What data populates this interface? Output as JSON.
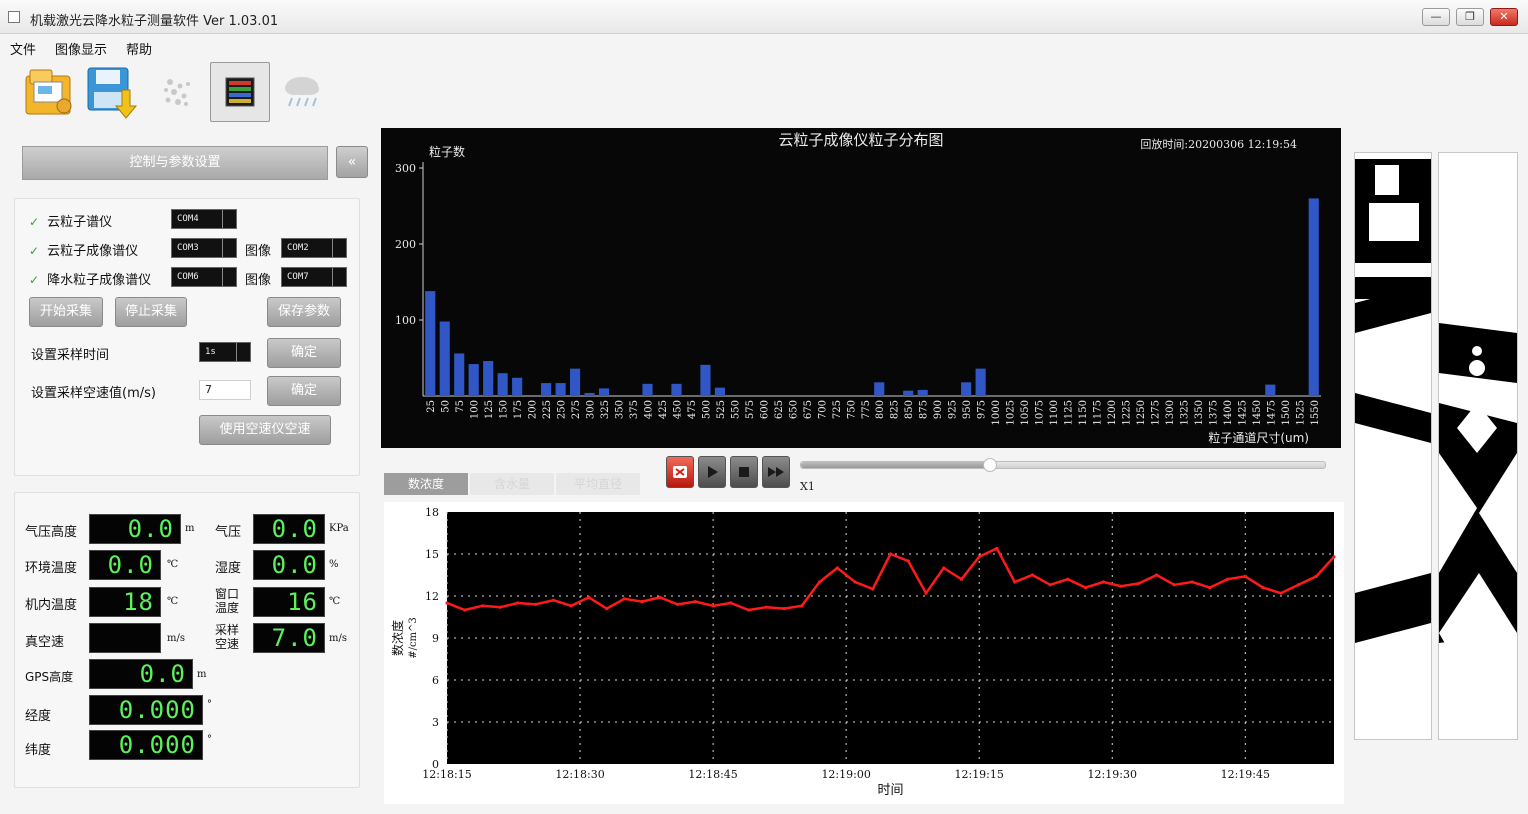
{
  "window": {
    "title": "机载激光云降水粒子测量软件 Ver 1.03.01",
    "buttons": {
      "minimize": "—",
      "maximize": "❐",
      "close": "✕"
    }
  },
  "menu": [
    "文件",
    "图像显示",
    "帮助"
  ],
  "toolbar": {
    "icons": [
      "open-folder-icon",
      "save-icon",
      "particles-icon",
      "color-bars-icon",
      "cloud-rain-icon"
    ]
  },
  "panel": {
    "header": "控制与参数设置",
    "collapse": "«",
    "instruments": [
      {
        "label": "云粒子谱仪",
        "port": "COM4"
      },
      {
        "label": "云粒子成像谱仪",
        "port": "COM3",
        "image_label": "图像",
        "image_port": "COM2"
      },
      {
        "label": "降水粒子成像谱仪",
        "port": "COM6",
        "image_label": "图像",
        "image_port": "COM7"
      }
    ],
    "start_button": "开始采集",
    "stop_button": "停止采集",
    "save_button": "保存参数",
    "sample_time_label": "设置采样时间",
    "sample_time_value": "1s",
    "sample_speed_label": "设置采样空速值(m/s)",
    "sample_speed_value": "7",
    "confirm_label": "确定",
    "use_airspeed_button": "使用空速仪空速"
  },
  "readouts": {
    "pressure_altitude": {
      "label": "气压高度",
      "value": "0.0",
      "unit": "m"
    },
    "pressure": {
      "label": "气压",
      "value": "0.0",
      "unit": "KPa"
    },
    "ambient_temp": {
      "label": "环境温度",
      "value": "0.0",
      "unit": "℃"
    },
    "humidity": {
      "label": "湿度",
      "value": "0.0",
      "unit": "%"
    },
    "internal_temp": {
      "label": "机内温度",
      "value": "18",
      "unit": "℃"
    },
    "window_temp": {
      "label1": "窗口",
      "label2": "温度",
      "value": "16",
      "unit": "℃"
    },
    "true_airspeed": {
      "label": "真空速",
      "value": "",
      "unit": "m/s"
    },
    "sample_airspeed": {
      "label1": "采样",
      "label2": "空速",
      "value": "7.0",
      "unit": "m/s"
    },
    "gps_altitude": {
      "label": "GPS高度",
      "value": "0.0",
      "unit": "m"
    },
    "longitude": {
      "label": "经度",
      "value": "0.000",
      "unit": "°"
    },
    "latitude": {
      "label": "纬度",
      "value": "0.000",
      "unit": "°"
    }
  },
  "histogram": {
    "title": "云粒子成像仪粒子分布图",
    "playback_time": "回放时间:20200306 12:19:54",
    "ylabel": "粒子数",
    "xlabel": "粒子通道尺寸(um)"
  },
  "tabs": [
    "数浓度",
    "含水量",
    "平均直径"
  ],
  "playback": {
    "speed": "X1",
    "position": 0.36
  },
  "linechart": {
    "ylabel_1": "数浓度",
    "ylabel_2": "#/cm^3",
    "xlabel": "时间"
  },
  "colors": {
    "bar": "#3157c6",
    "line": "#ff1a1a",
    "lcd_text": "#5cf25c",
    "panel_button": "#a8a8a8"
  },
  "chart_data": [
    {
      "type": "bar",
      "title": "云粒子成像仪粒子分布图",
      "xlabel": "粒子通道尺寸(um)",
      "ylabel": "粒子数",
      "ylim": [
        0,
        300
      ],
      "yticks": [
        100,
        200,
        300
      ],
      "categories": [
        "25",
        "50",
        "75",
        "100",
        "125",
        "150",
        "175",
        "200",
        "225",
        "250",
        "275",
        "300",
        "325",
        "350",
        "375",
        "400",
        "425",
        "450",
        "475",
        "500",
        "525",
        "550",
        "575",
        "600",
        "625",
        "650",
        "675",
        "700",
        "725",
        "750",
        "775",
        "800",
        "825",
        "850",
        "875",
        "900",
        "925",
        "950",
        "975",
        "1000",
        "1025",
        "1050",
        "1075",
        "1100",
        "1125",
        "1150",
        "1175",
        "1200",
        "1225",
        "1250",
        "1275",
        "1300",
        "1325",
        "1350",
        "1375",
        "1400",
        "1425",
        "1450",
        "1475",
        "1500",
        "1525",
        "1550"
      ],
      "values": [
        138,
        98,
        56,
        42,
        46,
        30,
        24,
        0,
        17,
        17,
        36,
        4,
        10,
        0,
        0,
        16,
        0,
        16,
        0,
        41,
        11,
        0,
        0,
        0,
        0,
        0,
        0,
        0,
        0,
        0,
        0,
        18,
        0,
        7,
        8,
        0,
        0,
        18,
        36,
        0,
        0,
        0,
        0,
        0,
        0,
        0,
        0,
        0,
        0,
        0,
        0,
        0,
        0,
        0,
        0,
        0,
        0,
        0,
        15,
        0,
        0,
        260
      ],
      "grid": false
    },
    {
      "type": "line",
      "xlabel": "时间",
      "ylabel": "数浓度 #/cm^3",
      "ylim": [
        0,
        18
      ],
      "yticks": [
        0,
        3,
        6,
        9,
        12,
        15,
        18
      ],
      "xlim": [
        "12:18:15",
        "12:19:55"
      ],
      "xticks": [
        "12:18:15",
        "12:18:30",
        "12:18:45",
        "12:19:00",
        "12:19:15",
        "12:19:30",
        "12:19:45"
      ],
      "grid": true,
      "series": [
        {
          "x": [
            "12:18:15",
            "12:18:17",
            "12:18:19",
            "12:18:21",
            "12:18:23",
            "12:18:25",
            "12:18:27",
            "12:18:29",
            "12:18:31",
            "12:18:33",
            "12:18:35",
            "12:18:37",
            "12:18:39",
            "12:18:41",
            "12:18:43",
            "12:18:45",
            "12:18:47",
            "12:18:49",
            "12:18:51",
            "12:18:53",
            "12:18:55",
            "12:18:57",
            "12:18:59",
            "12:19:01",
            "12:19:03",
            "12:19:05",
            "12:19:07",
            "12:19:09",
            "12:19:11",
            "12:19:13",
            "12:19:15",
            "12:19:17",
            "12:19:19",
            "12:19:21",
            "12:19:23",
            "12:19:25",
            "12:19:27",
            "12:19:29",
            "12:19:31",
            "12:19:33",
            "12:19:35",
            "12:19:37",
            "12:19:39",
            "12:19:41",
            "12:19:43",
            "12:19:45",
            "12:19:47",
            "12:19:49",
            "12:19:51",
            "12:19:53",
            "12:19:55"
          ],
          "values": [
            11.5,
            11.0,
            11.3,
            11.2,
            11.5,
            11.4,
            11.7,
            11.3,
            11.9,
            11.1,
            11.8,
            11.6,
            11.9,
            11.4,
            11.6,
            11.3,
            11.5,
            11.0,
            11.2,
            11.1,
            11.3,
            13.0,
            14.0,
            13.0,
            12.5,
            15.0,
            14.5,
            12.2,
            14.0,
            13.2,
            14.8,
            15.4,
            13.0,
            13.5,
            12.8,
            13.2,
            12.6,
            13.0,
            12.7,
            12.9,
            13.5,
            12.8,
            13.0,
            12.6,
            13.2,
            13.4,
            12.6,
            12.2,
            12.8,
            13.4,
            14.8
          ]
        }
      ]
    }
  ]
}
